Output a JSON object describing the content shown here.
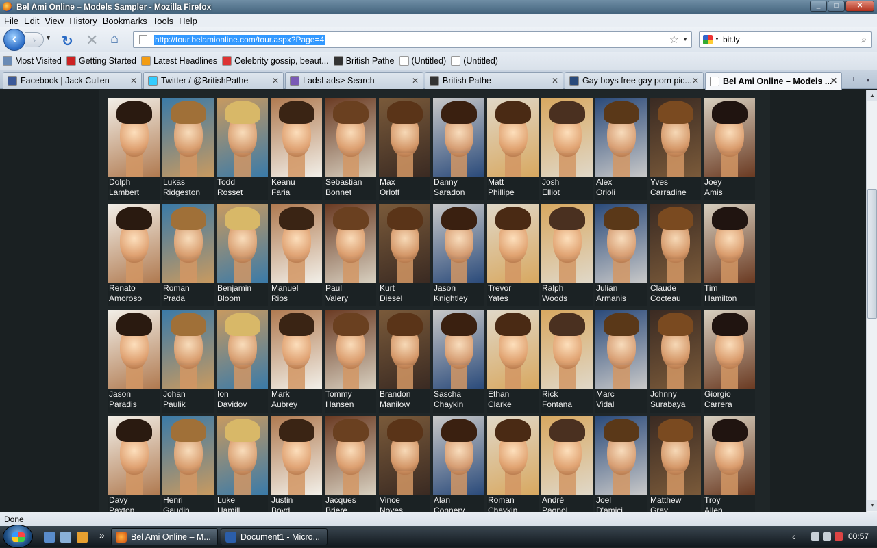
{
  "window": {
    "title": "Bel Ami Online – Models Sampler - Mozilla Firefox",
    "buttons": [
      "_",
      "□",
      "✕"
    ]
  },
  "menu": [
    "File",
    "Edit",
    "View",
    "History",
    "Bookmarks",
    "Tools",
    "Help"
  ],
  "nav": {
    "url": "http://tour.belamionline.com/tour.aspx?Page=4",
    "search_value": "bit.ly"
  },
  "bookmarks": [
    {
      "label": "Most Visited",
      "color": "#6a8bb5"
    },
    {
      "label": "Getting Started",
      "color": "#c22"
    },
    {
      "label": "Latest Headlines",
      "color": "#f39c12"
    },
    {
      "label": "Celebrity gossip, beaut...",
      "color": "#d33"
    },
    {
      "label": "British Pathe",
      "color": "#333"
    },
    {
      "label": "(Untitled)",
      "color": "#fff"
    },
    {
      "label": "(Untitled)",
      "color": "#fff"
    }
  ],
  "tabs": [
    {
      "label": "Facebook | Jack Cullen",
      "color": "#3b5998",
      "active": false
    },
    {
      "label": "Twitter / @BritishPathe",
      "color": "#33ccff",
      "active": false
    },
    {
      "label": "LadsLads> Search",
      "color": "#7a5ab5",
      "active": false
    },
    {
      "label": "British Pathe",
      "color": "#333",
      "active": false
    },
    {
      "label": "Gay boys free gay porn pic...",
      "color": "#2a4a7a",
      "active": false
    },
    {
      "label": "Bel Ami Online – Models ...",
      "color": "#fff",
      "active": true
    }
  ],
  "tab_controls": {
    "new_tab": "+",
    "list": "▾"
  },
  "models": [
    "Dolph\nLambert",
    "Lukas\nRidgeston",
    "Todd\nRosset",
    "Keanu\nFaria",
    "Sebastian\nBonnet",
    "Max\nOrloff",
    "Danny\nSaradon",
    "Matt\nPhillipe",
    "Josh\nElliot",
    "Alex\nOrioli",
    "Yves\nCarradine",
    "Joey\nAmis",
    "Renato\nAmoroso",
    "Roman\nPrada",
    "Benjamin\nBloom",
    "Manuel\nRios",
    "Paul\nValery",
    "Kurt\nDiesel",
    "Jason\nKnightley",
    "Trevor\nYates",
    "Ralph\nWoods",
    "Julian\nArmanis",
    "Claude\nCocteau",
    "Tim\nHamilton",
    "Jason\nParadis",
    "Johan\nPaulik",
    "Ion\nDavidov",
    "Mark\nAubrey",
    "Tommy\nHansen",
    "Brandon\nManilow",
    "Sascha\nChaykin",
    "Ethan\nClarke",
    "Rick\nFontana",
    "Marc\nVidal",
    "Johnny\nSurabaya",
    "Giorgio\nCarrera",
    "Davy\nPaxton",
    "Henri\nGaudin",
    "Luke\nHamill",
    "Justin\nBoyd",
    "Jacques\nBriere",
    "Vince\nNoyes",
    "Alan\nConnery",
    "Roman\nChaykin",
    "André\nPagnol",
    "Joel\nD'amici",
    "Matthew\nGray",
    "Troy\nAllen"
  ],
  "status": "Done",
  "taskbar": {
    "tasks": [
      "Bel Ami Online – M...",
      "Document1 - Micro..."
    ],
    "clock": "00:57"
  },
  "colors": {
    "page_bg": "#1f2628",
    "name_text": "#f0f0f0"
  }
}
